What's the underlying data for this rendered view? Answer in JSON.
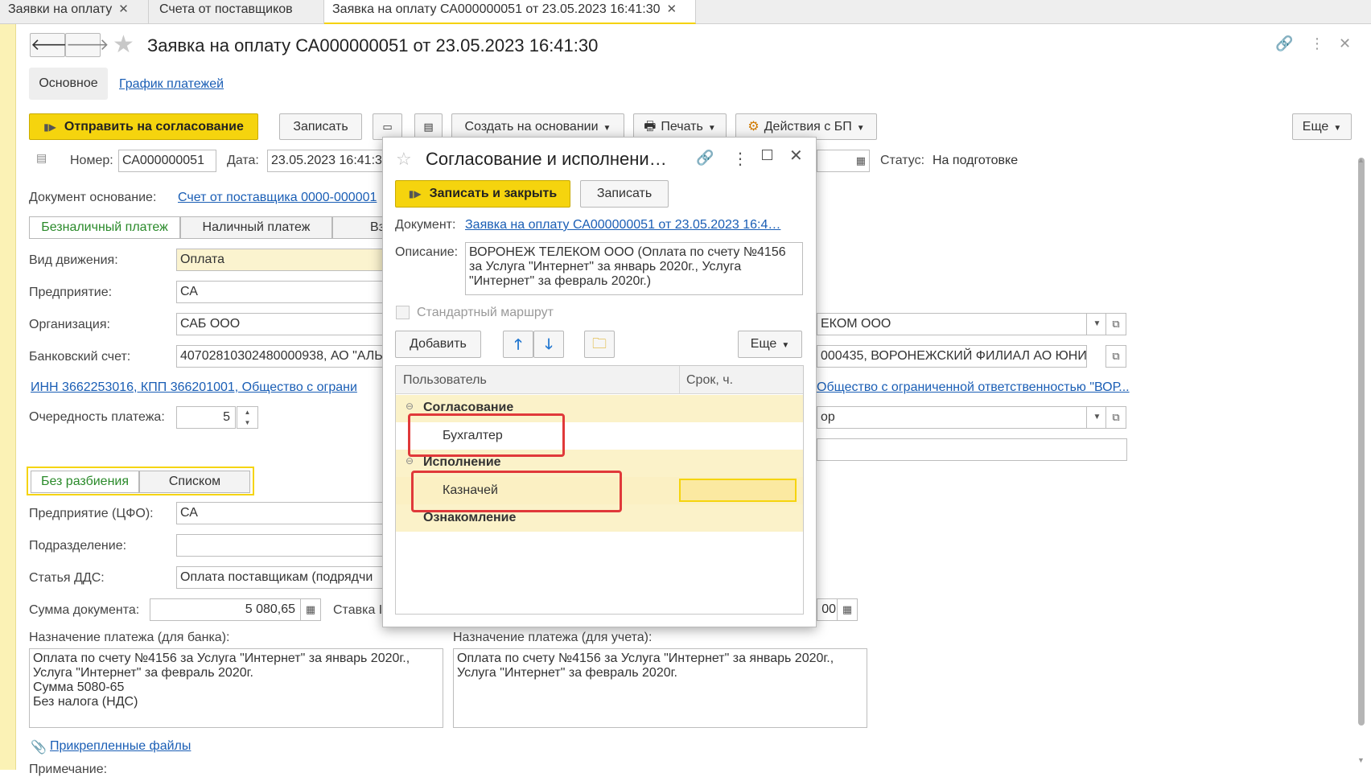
{
  "tabs": [
    {
      "label": "Заявки на оплату"
    },
    {
      "label": "Счета от поставщиков"
    },
    {
      "label": "Заявка на оплату СА000000051 от 23.05.2023 16:41:30"
    }
  ],
  "header": {
    "title": "Заявка на оплату СА000000051 от 23.05.2023 16:41:30"
  },
  "subtabs": {
    "main": "Основное",
    "schedule": "График платежей"
  },
  "toolbar": {
    "send": "Отправить на согласование",
    "save": "Записать",
    "create_based": "Создать на основании",
    "print": "Печать",
    "bp_actions": "Действия с БП",
    "more": "Еще"
  },
  "doc": {
    "number_label": "Номер:",
    "number": "СА000000051",
    "date_label": "Дата:",
    "date": "23.05.2023 16:41:3",
    "status_label": "Статус:",
    "status": "На подготовке",
    "basis_label": "Документ основание:",
    "basis": "Счет от поставщика 0000-000001"
  },
  "paytype": {
    "cashless": "Безналичный платеж",
    "cash": "Наличный платеж",
    "other": "Вз"
  },
  "fields": {
    "movement_label": "Вид движения:",
    "movement": "Оплата",
    "enterprise_label": "Предприятие:",
    "enterprise": "СА",
    "org_label": "Организация:",
    "org": "САБ ООО",
    "bank_label": "Банковский счет:",
    "bank": "40702810302480000938, АО \"АЛЬ",
    "inn_link": "ИНН 3662253016, КПП 366201001, Общество с ограни",
    "priority_label": "Очередность платежа:",
    "priority": "5",
    "counterparty": "ЕКОМ ООО",
    "counterparty_bank": "000435, ВОРОНЕЖСКИЙ ФИЛИАЛ АО ЮНИ",
    "counterparty_link": "Общество с ограниченной ответственностью \"ВОР...",
    "contract": "ор"
  },
  "split": {
    "none": "Без разбиения",
    "list": "Списком"
  },
  "analytics": {
    "cfo_label": "Предприятие (ЦФО):",
    "cfo": "СА",
    "dept_label": "Подразделение:",
    "dept": "",
    "dds_label": "Статья ДДС:",
    "dds": "Оплата поставщикам (подрядчи",
    "sum_label": "Сумма документа:",
    "sum": "5 080,65",
    "rate_label": "Ставка I",
    "vat_sum": "00"
  },
  "purpose": {
    "bank_label": "Назначение платежа (для банка):",
    "bank_text": "Оплата по счету №4156 за Услуга \"Интернет\" за январь 2020г.,\nУслуга \"Интернет\" за февраль 2020г.\nСумма 5080-65\nБез налога (НДС)",
    "acc_label": "Назначение платежа (для учета):",
    "acc_text": "Оплата по счету №4156 за Услуга \"Интернет\" за январь 2020г.,\nУслуга \"Интернет\" за февраль 2020г."
  },
  "attached_files": "Прикрепленные файлы",
  "note_label": "Примечание:",
  "modal": {
    "title": "Согласование и исполнени…",
    "save_close": "Записать и закрыть",
    "save": "Записать",
    "doc_label": "Документ:",
    "doc_link": "Заявка на оплату СА000000051 от 23.05.2023 16:4…",
    "desc_label": "Описание:",
    "desc_text": "ВОРОНЕЖ ТЕЛЕКОМ ООО (Оплата по счету №4156 за Услуга \"Интернет\" за январь 2020г., Услуга \"Интернет\" за февраль 2020г.)",
    "std_route": "Стандартный маршрут",
    "add": "Добавить",
    "more": "Еще",
    "col_user": "Пользователь",
    "col_term": "Срок, ч.",
    "rows": {
      "group1": "Согласование",
      "user1": "Бухгалтер",
      "group2": "Исполнение",
      "user2": "Казначей",
      "group3": "Ознакомление"
    }
  },
  "colors": {
    "accent": "#f5d40e",
    "link": "#1a5eb5",
    "highlight": "#e0393a"
  }
}
